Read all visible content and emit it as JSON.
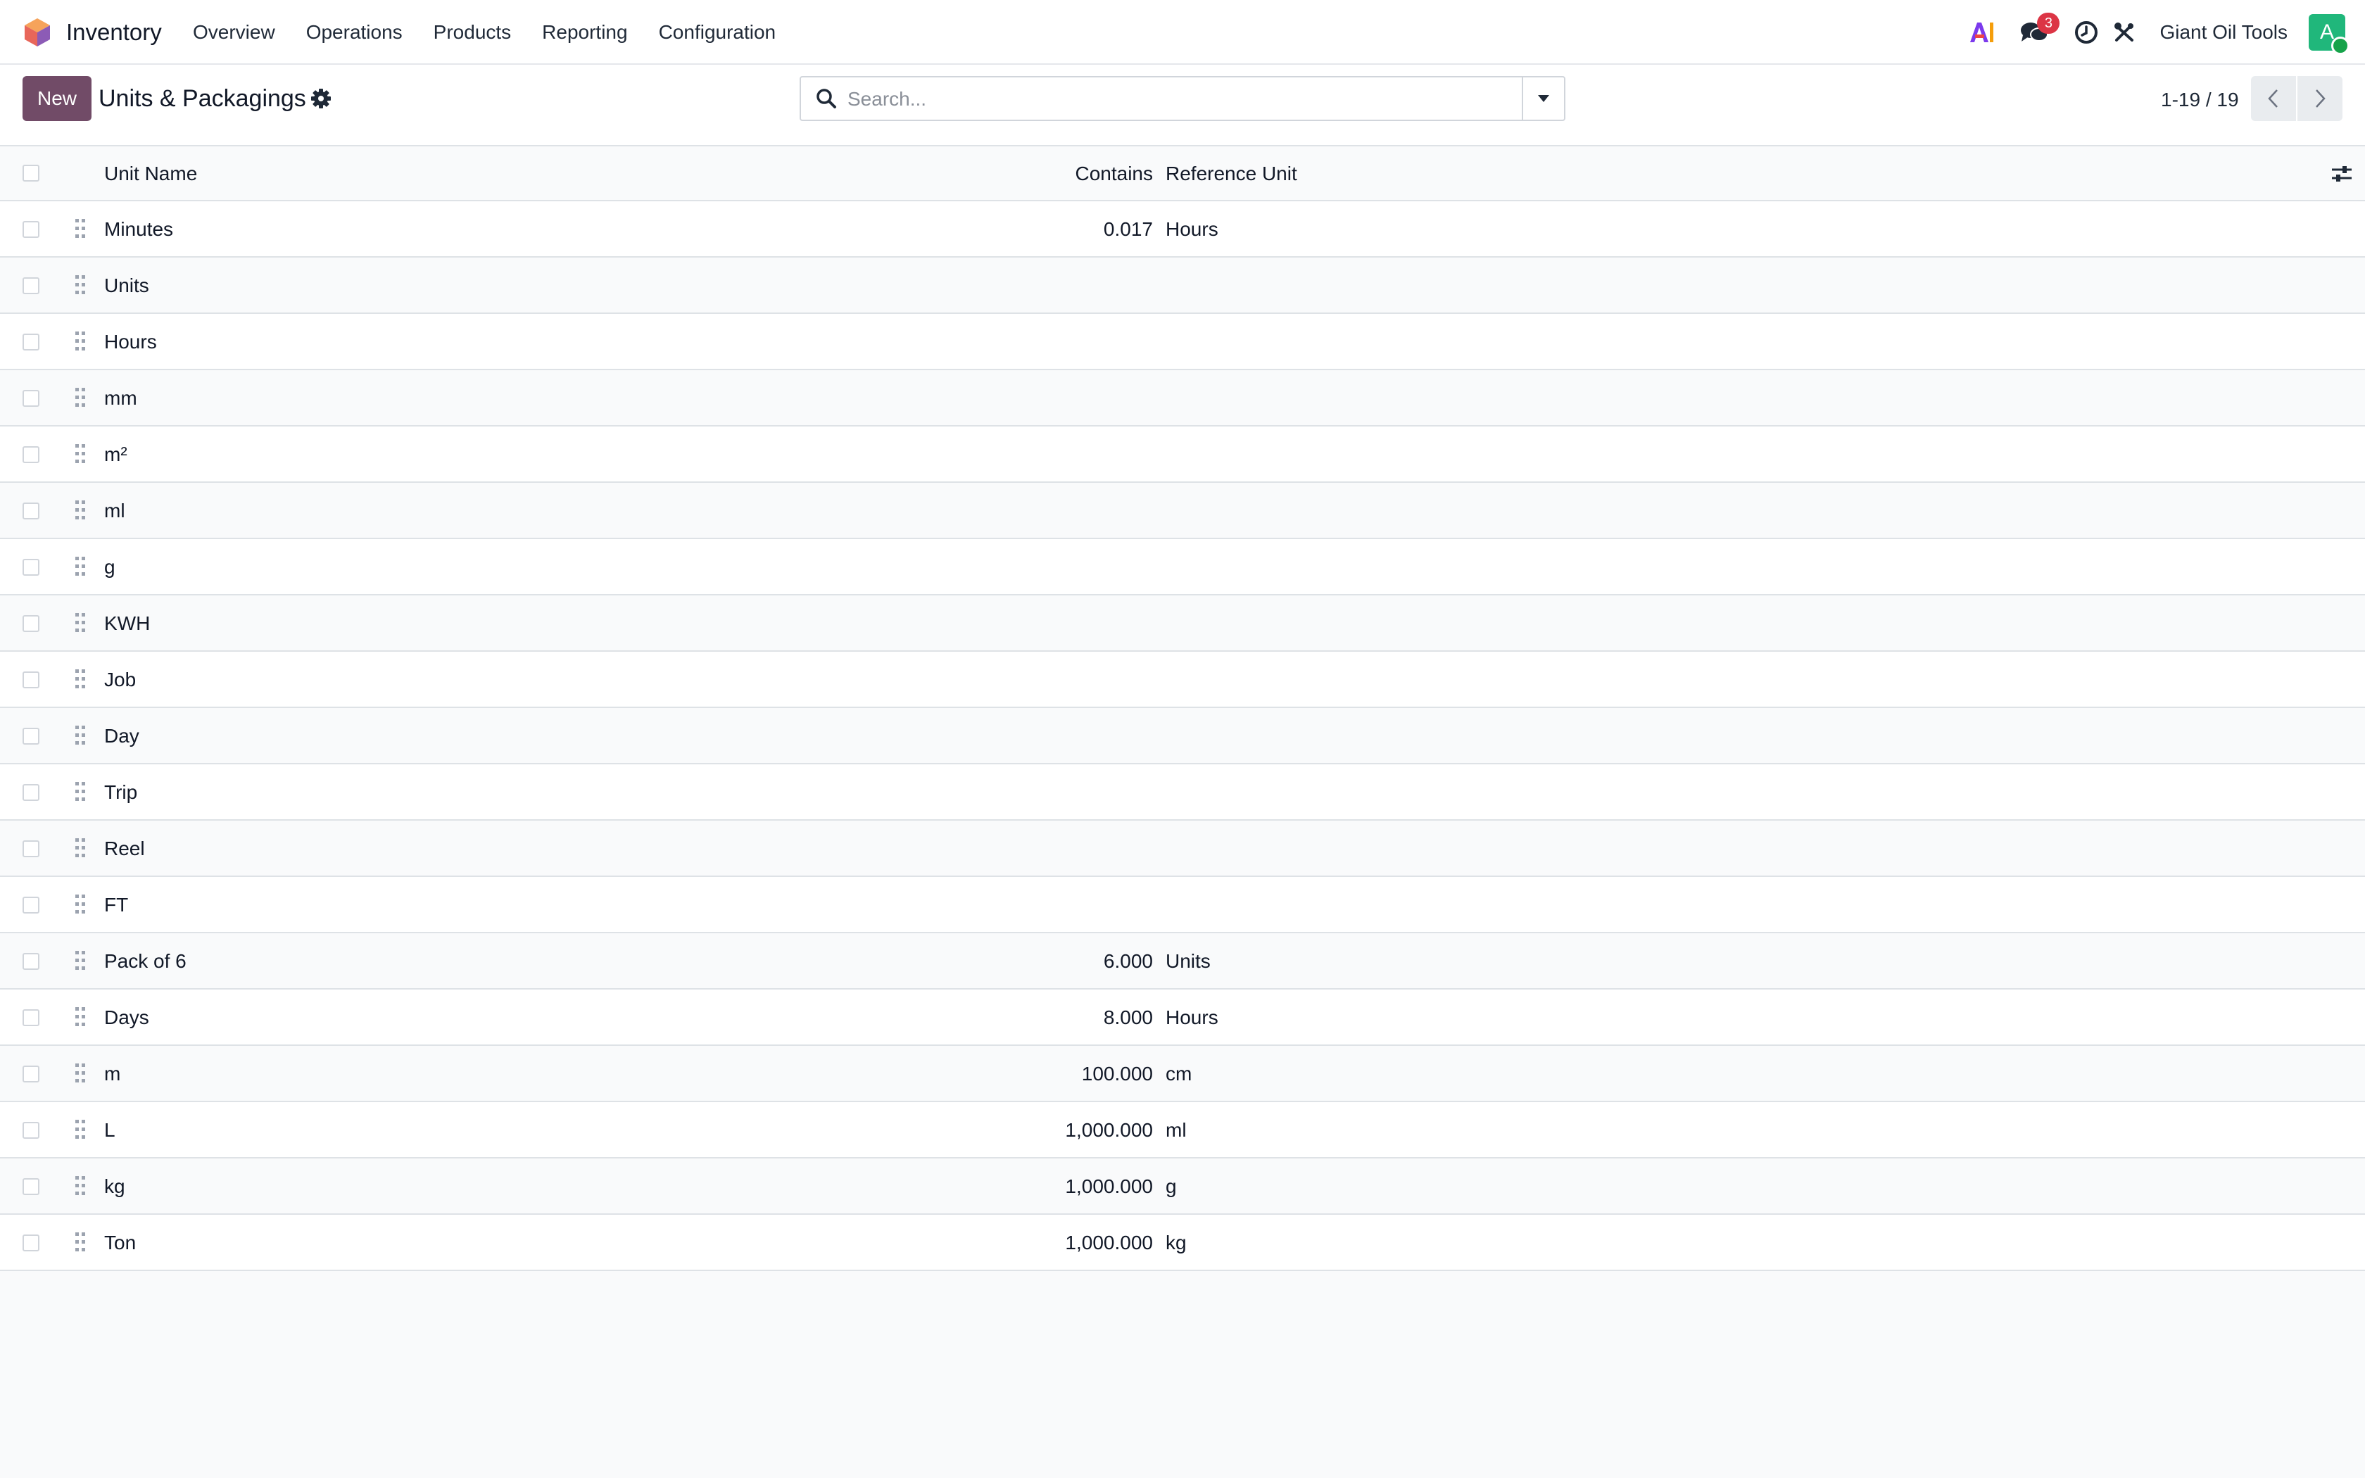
{
  "app": {
    "name": "Inventory",
    "brand_color": "#714b67"
  },
  "nav": {
    "items": [
      {
        "label": "Overview"
      },
      {
        "label": "Operations"
      },
      {
        "label": "Products"
      },
      {
        "label": "Reporting"
      },
      {
        "label": "Configuration"
      }
    ]
  },
  "systray": {
    "ai_icon": "ai-icon",
    "messages_icon": "chat-bubbles-icon",
    "messages_count": "3",
    "activity_icon": "clock-icon",
    "tools_icon": "tools-icon",
    "company_name": "Giant Oil Tools",
    "avatar_letter": "A",
    "avatar_color": "#20b77b"
  },
  "control_panel": {
    "new_label": "New",
    "title": "Units & Packagings",
    "search_placeholder": "Search...",
    "pager": "1-19 / 19"
  },
  "table": {
    "columns": {
      "name": "Unit Name",
      "contains": "Contains",
      "reference": "Reference Unit"
    },
    "rows": [
      {
        "name": "Minutes",
        "contains": "0.017",
        "reference": "Hours"
      },
      {
        "name": "Units",
        "contains": "",
        "reference": ""
      },
      {
        "name": "Hours",
        "contains": "",
        "reference": ""
      },
      {
        "name": "mm",
        "contains": "",
        "reference": ""
      },
      {
        "name": "m²",
        "contains": "",
        "reference": ""
      },
      {
        "name": "ml",
        "contains": "",
        "reference": ""
      },
      {
        "name": "g",
        "contains": "",
        "reference": ""
      },
      {
        "name": "KWH",
        "contains": "",
        "reference": ""
      },
      {
        "name": "Job",
        "contains": "",
        "reference": ""
      },
      {
        "name": "Day",
        "contains": "",
        "reference": ""
      },
      {
        "name": "Trip",
        "contains": "",
        "reference": ""
      },
      {
        "name": "Reel",
        "contains": "",
        "reference": ""
      },
      {
        "name": "FT",
        "contains": "",
        "reference": ""
      },
      {
        "name": "Pack of 6",
        "contains": "6.000",
        "reference": "Units"
      },
      {
        "name": "Days",
        "contains": "8.000",
        "reference": "Hours"
      },
      {
        "name": "m",
        "contains": "100.000",
        "reference": "cm"
      },
      {
        "name": "L",
        "contains": "1,000.000",
        "reference": "ml"
      },
      {
        "name": "kg",
        "contains": "1,000.000",
        "reference": "g"
      },
      {
        "name": "Ton",
        "contains": "1,000.000",
        "reference": "kg"
      }
    ]
  }
}
